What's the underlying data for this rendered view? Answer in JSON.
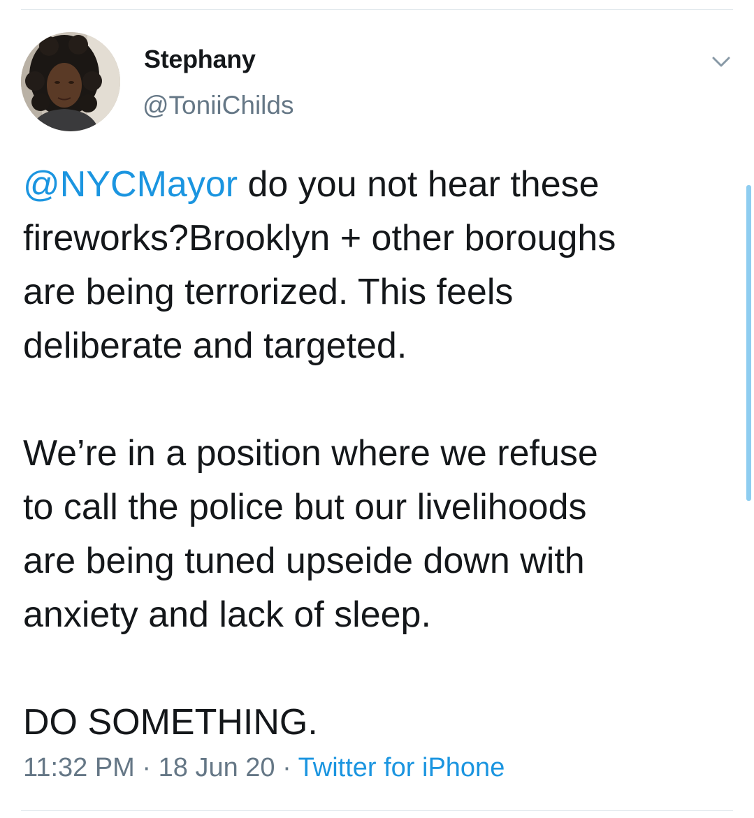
{
  "author": {
    "display_name": "Stephany",
    "handle": "@ToniiChilds",
    "avatar_icon": "user-avatar"
  },
  "menu": {
    "icon": "chevron-down-icon"
  },
  "tweet": {
    "line1_mention": "@NYCMayor",
    "line1_rest": " do you not hear these",
    "line2": "fireworks?Brooklyn + other boroughs",
    "line3": "are being terrorized. This feels",
    "line4": "deliberate and targeted.",
    "line5": "We’re in a position where we refuse",
    "line6": "to call the police but our livelihoods",
    "line7": "are being tuned upseide down with",
    "line8": "anxiety and lack of sleep.",
    "line9": "DO SOMETHING."
  },
  "meta": {
    "time": "11:32 PM",
    "separator1": " · ",
    "date": "18 Jun 20",
    "separator2": " · ",
    "source": "Twitter for iPhone"
  },
  "colors": {
    "link": "#1b95e0",
    "secondary_text": "#657786",
    "primary_text": "#14171a",
    "divider": "#e1e8ed"
  }
}
